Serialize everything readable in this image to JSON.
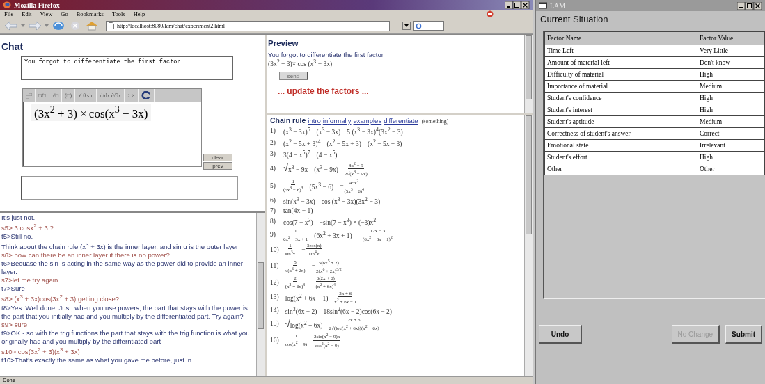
{
  "browser": {
    "title": "Mozilla Firefox",
    "menu": [
      "File",
      "Edit",
      "View",
      "Go",
      "Bookmarks",
      "Tools",
      "Help"
    ],
    "url": "http://localhost:8080/lam/chat/experiment2.html",
    "status": "Done"
  },
  "chat": {
    "heading": "Chat",
    "draft": "You forgot to differentiate the first factor",
    "palette": [
      "□$^{□}$",
      "□⁄□",
      "√□",
      "(□)",
      "∠θ sin",
      "d/dx ∂/∂x",
      "÷ ×"
    ],
    "formula_before": "(3x$^{2}$ + 3) × ",
    "formula_after": "cos(x$^{3}$ − 3x)",
    "buttons": [
      "clear",
      "prev"
    ],
    "log": [
      {
        "kind": "tutor",
        "text": "It's just not."
      },
      {
        "kind": "student",
        "text": "s5> 3 cosx$^{2}$ + 3 ?"
      },
      {
        "kind": "tutor",
        "text": "t5>Still no."
      },
      {
        "kind": "tutor",
        "text": "Think about the chain rule (x$^{3}$ + 3x) is the inner layer, and sin u is the outer layer"
      },
      {
        "kind": "student",
        "text": "s6> how can there be an inner layer if there is no power?"
      },
      {
        "kind": "tutor",
        "text": "t6>Becuase the sin is acting in the same way as the power did to provide an inner layer."
      },
      {
        "kind": "student",
        "text": "s7>let me try again"
      },
      {
        "kind": "tutor",
        "text": "t7>Sure"
      },
      {
        "kind": "student",
        "text": "s8> (x$^{3}$ + 3x)cos(3x$^{2}$ + 3) getting close?"
      },
      {
        "kind": "tutor",
        "text": "t8>Yes. Well done. Just, when you use powers, the part that stays with the power is the part that you initially had and you multiply by the differentiated part. Try again?"
      },
      {
        "kind": "student",
        "text": "s9> sure"
      },
      {
        "kind": "tutor",
        "text": "t9>OK - so with the trig functions the part that stays with the trig function is what you originally had and you multiply by the differntiated part"
      },
      {
        "kind": "student",
        "text": "s10> cos(3x$^{2}$ + 3)(x$^{3}$ + 3x)"
      },
      {
        "kind": "tutor",
        "text": "t10>That's exactly the same as what you gave me before, just in"
      }
    ]
  },
  "preview": {
    "heading": "Preview",
    "message": "You forgot to differentiate the first factor",
    "formula": "(3x$^{2}$ + 3)×  cos (x$^{3}$ − 3x)",
    "send": {
      "label": "send",
      "disabled": true
    },
    "update": "... update the factors ..."
  },
  "lesson": {
    "title": "Chain rule",
    "links": [
      "intro",
      "informally",
      "examples",
      "differentiate"
    ],
    "note": "(something)",
    "examples": [
      {
        "label": "1)",
        "terms": [
          {
            "kind": "text",
            "text": "(x$^{3}$ − 3x)$^{5}$"
          },
          {
            "kind": "text",
            "text": "(x$^{3}$ − 3x)"
          },
          {
            "kind": "text",
            "text": "5 (x$^{3}$ − 3x)$^{4}$(3x$^{2}$ − 3)"
          }
        ]
      },
      {
        "label": "2)",
        "terms": [
          {
            "kind": "text",
            "text": "(x$^{2}$ − 5x + 3)$^{4}$"
          },
          {
            "kind": "text",
            "text": "(x$^{2}$ − 5x + 3)"
          },
          {
            "kind": "text",
            "text": "(x$^{2}$ − 5x + 3)"
          }
        ]
      },
      {
        "label": "3)",
        "terms": [
          {
            "kind": "text",
            "text": "3(4 − x$^{5}$)$^{7}$"
          },
          {
            "kind": "text",
            "text": "(4 − x$^{5}$)"
          }
        ]
      },
      {
        "label": "4)",
        "terms": [
          {
            "kind": "sqrt",
            "text": "x$^{3}$ − 9x"
          },
          {
            "kind": "text",
            "text": "(x$^{3}$ − 9x)"
          },
          {
            "kind": "frac",
            "num": "3x$^{2}$ − 9",
            "den": "2√(x$^{3}$ − 9x)"
          }
        ]
      },
      {
        "label": "5)",
        "terms": [
          {
            "kind": "frac",
            "num": "1",
            "den": "(5x$^{3}$ − 6)$^{3}$"
          },
          {
            "kind": "text",
            "text": "(5x$^{3}$ − 6)"
          },
          {
            "kind": "frac",
            "sign": "−",
            "num": "45x$^{2}$",
            "den": "(5x$^{3}$ − 6)$^{4}$"
          }
        ]
      },
      {
        "label": "6)",
        "terms": [
          {
            "kind": "text",
            "text": "sin(x$^{3}$ − 3x)"
          },
          {
            "kind": "text",
            "text": "cos (x$^{3}$ − 3x)(3x$^{2}$ − 3)"
          }
        ]
      },
      {
        "label": "7)",
        "terms": [
          {
            "kind": "text",
            "text": "tan(4x − 1)"
          }
        ]
      },
      {
        "label": "8)",
        "terms": [
          {
            "kind": "text",
            "text": "cos(7 − x$^{3}$)"
          },
          {
            "kind": "text",
            "text": "−sin(7 − x$^{3}$) × (−3)x$^{2}$"
          }
        ]
      },
      {
        "label": "9)",
        "terms": [
          {
            "kind": "frac",
            "num": "1",
            "den": "6x$^{2}$ − 3x + 1"
          },
          {
            "kind": "text",
            "text": "(6x$^{2}$ + 3x + 1)"
          },
          {
            "kind": "frac",
            "sign": "−",
            "num": "12x − 3",
            "den": "(6x$^{2}$ − 3x + 1)$^{2}$"
          }
        ]
      },
      {
        "label": "10)",
        "terms": [
          {
            "kind": "frac",
            "num": "1",
            "den": "sin$^{3}$x"
          },
          {
            "kind": "frac",
            "sign": "−",
            "num": "3cos(x)",
            "den": "sin$^{4}$x"
          }
        ]
      },
      {
        "label": "11)",
        "terms": [
          {
            "kind": "frac",
            "num": "5",
            "den": "√(x$^{6}$ + 2x)"
          },
          {
            "kind": "frac",
            "sign": "−",
            "num": "5(6x$^{5}$ + 2)",
            "den": "2(x$^{6}$ + 2x)$^{3/2}$"
          }
        ]
      },
      {
        "label": "12)",
        "terms": [
          {
            "kind": "frac",
            "num": "2",
            "den": "(x$^{2}$ + 6x)$^{3}$"
          },
          {
            "kind": "frac",
            "sign": "−",
            "num": "6(2x + 6)",
            "den": "(x$^{2}$ + 6x)$^{4}$"
          }
        ]
      },
      {
        "label": "13)",
        "terms": [
          {
            "kind": "text",
            "text": "log(x$^{2}$ + 6x − 1)"
          },
          {
            "kind": "frac",
            "num": "2x + 6",
            "den": "x$^{2}$ + 6x − 1"
          }
        ]
      },
      {
        "label": "14)",
        "terms": [
          {
            "kind": "text",
            "text": "sin$^{3}$(6x − 2)"
          },
          {
            "kind": "text",
            "text": "18sin$^{2}$(6x − 2)cos(6x − 2)"
          }
        ]
      },
      {
        "label": "15)",
        "terms": [
          {
            "kind": "sqrt",
            "text": "log(x$^{2}$ + 6x)"
          },
          {
            "kind": "frac",
            "num": "2x + 6",
            "den": "2√(log(x$^{2}$ + 6x))(x$^{2}$ + 6x)"
          }
        ]
      },
      {
        "label": "16)",
        "terms": [
          {
            "kind": "frac",
            "num": "1",
            "den": "cos(x$^{2}$ − 9)"
          },
          {
            "kind": "frac",
            "num": "2sin(x$^{2}$ − 9)x",
            "den": "cos$^{2}$(x$^{2}$ − 9)"
          }
        ]
      }
    ]
  },
  "lam": {
    "title": "LAM",
    "heading": "Current Situation",
    "columns": [
      "Factor Name",
      "Factor Value"
    ],
    "rows": [
      [
        "Time Left",
        "Very Little"
      ],
      [
        "Amount of material left",
        "Don't know"
      ],
      [
        "Difficulty of material",
        "High"
      ],
      [
        "Importance of material",
        "Medium"
      ],
      [
        "Student's confidence",
        "High"
      ],
      [
        "Student's interest",
        "High"
      ],
      [
        "Student's aptitude",
        "Medium"
      ],
      [
        "Correctness of student's answer",
        "Correct"
      ],
      [
        "Emotional state",
        "Irrelevant"
      ],
      [
        "Student's effort",
        "High"
      ],
      [
        "Other",
        "Other"
      ]
    ],
    "buttons": [
      {
        "label": "Undo",
        "disabled": false
      },
      {
        "label": "No Change",
        "disabled": true
      },
      {
        "label": "Submit",
        "disabled": false
      }
    ]
  }
}
